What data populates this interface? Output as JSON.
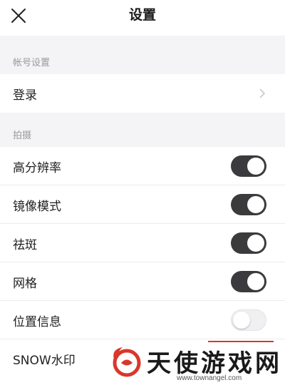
{
  "header": {
    "title": "设置",
    "close_icon": "close-icon"
  },
  "sections": [
    {
      "header": "帐号设置",
      "rows": [
        {
          "label": "登录",
          "control": "chevron"
        }
      ]
    },
    {
      "header": "拍摄",
      "rows": [
        {
          "label": "高分辨率",
          "control": "toggle",
          "on": true
        },
        {
          "label": "镜像模式",
          "control": "toggle",
          "on": true
        },
        {
          "label": "祛斑",
          "control": "toggle",
          "on": true
        },
        {
          "label": "网格",
          "control": "toggle",
          "on": true
        },
        {
          "label": "位置信息",
          "control": "toggle",
          "on": false
        },
        {
          "label": "SNOW水印",
          "control": "toggle"
        }
      ]
    }
  ],
  "watermark": {
    "name": "天使游戏网",
    "url": "www.townangel.com"
  },
  "colors": {
    "toggle_on": "#3b3b3d",
    "toggle_off": "#f0f0f2",
    "section_bg": "#f4f4f6",
    "watermark_accent": "#d9372c"
  }
}
